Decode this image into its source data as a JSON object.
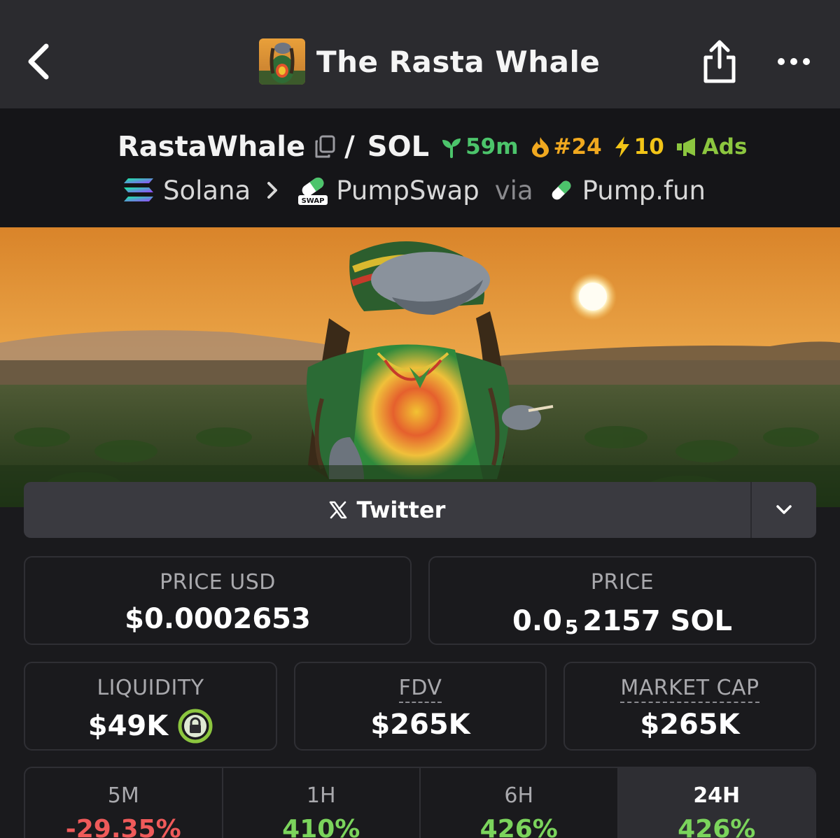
{
  "header": {
    "title": "The Rasta Whale"
  },
  "pair": {
    "base": "RastaWhale",
    "separator": "/",
    "quote": "SOL",
    "age": "59m",
    "trending_rank": "#24",
    "boosts": "10",
    "ads_label": "Ads",
    "chain": "Solana",
    "dex": "PumpSwap",
    "dex_badge": "SWAP",
    "via": "via",
    "launchpad": "Pump.fun"
  },
  "social": {
    "twitter_label": "Twitter"
  },
  "stats": {
    "price_usd": {
      "label": "PRICE USD",
      "value": "$0.0002653"
    },
    "price_native": {
      "label": "PRICE",
      "prefix": "0.0",
      "zeros": "5",
      "suffix": "2157 SOL"
    },
    "liquidity": {
      "label": "LIQUIDITY",
      "value": "$49K"
    },
    "fdv": {
      "label": "FDV",
      "value": "$265K"
    },
    "market_cap": {
      "label": "MARKET CAP",
      "value": "$265K"
    }
  },
  "timeframes": [
    {
      "label": "5M",
      "change": "-29.35%",
      "active": false
    },
    {
      "label": "1H",
      "change": "410%",
      "active": false
    },
    {
      "label": "6H",
      "change": "426%",
      "active": false
    },
    {
      "label": "24H",
      "change": "426%",
      "active": true
    }
  ],
  "colors": {
    "positive": "#7bd45c",
    "negative": "#ef5a5a",
    "age": "#4cc46b",
    "trending": "#f0a81f",
    "boost": "#f2c417",
    "ads": "#8cc63f"
  }
}
